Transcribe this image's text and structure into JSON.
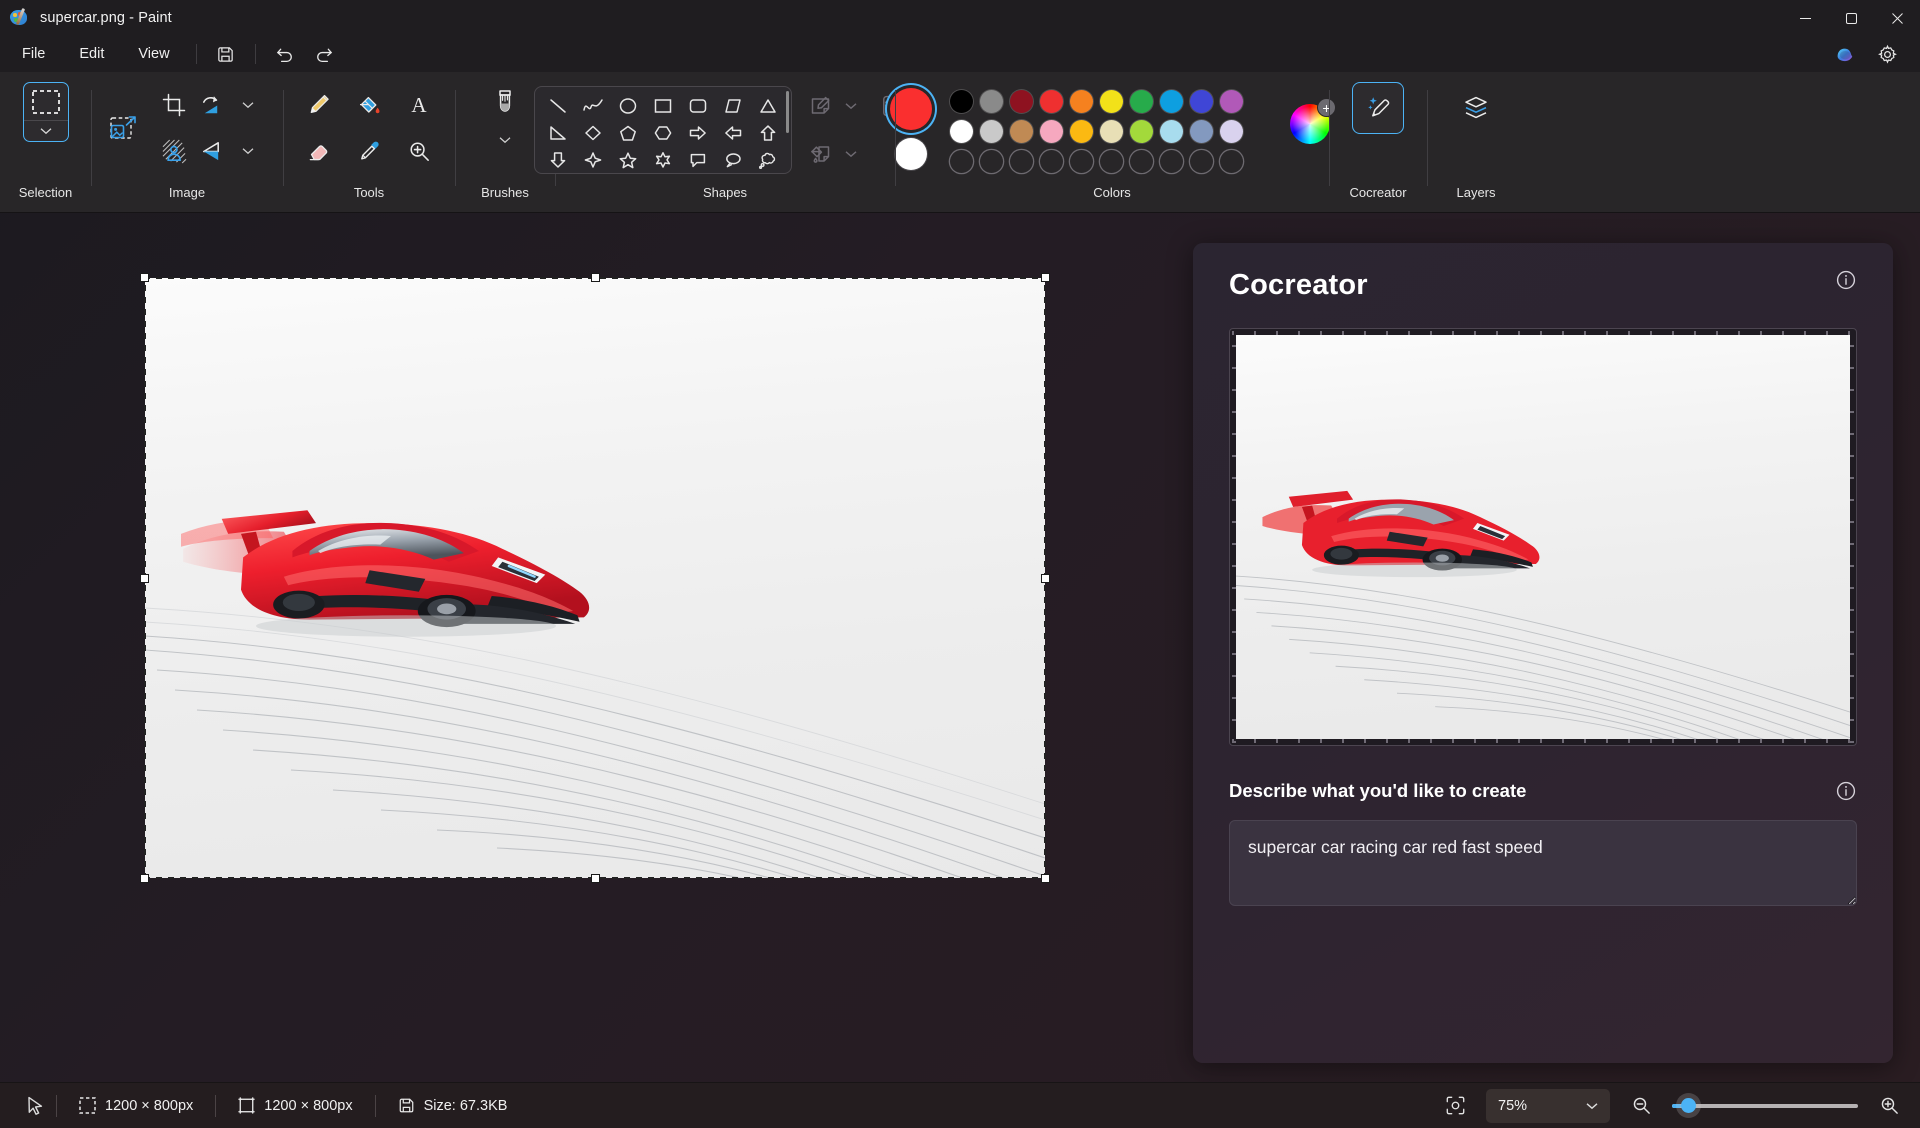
{
  "window": {
    "title": "supercar.png - Paint",
    "app_icon": "paint-palette-icon",
    "minimize": "minimize-icon",
    "maximize": "maximize-icon",
    "close": "close-icon"
  },
  "menubar": {
    "items": [
      {
        "label": "File"
      },
      {
        "label": "Edit"
      },
      {
        "label": "View"
      }
    ],
    "quick_actions": [
      {
        "name": "save-icon",
        "tooltip": "Save"
      },
      {
        "name": "undo-icon",
        "tooltip": "Undo"
      },
      {
        "name": "redo-icon",
        "tooltip": "Redo"
      }
    ],
    "right_actions": [
      {
        "name": "copilot-icon",
        "tooltip": "Copilot"
      },
      {
        "name": "settings-gear-icon",
        "tooltip": "Settings"
      }
    ]
  },
  "ribbon": {
    "groups": [
      {
        "label": "Selection",
        "active": true
      },
      {
        "label": "Image"
      },
      {
        "label": "Tools"
      },
      {
        "label": "Brushes"
      },
      {
        "label": "Shapes"
      },
      {
        "label": "Colors"
      },
      {
        "label": "Cocreator",
        "active": true
      },
      {
        "label": "Layers"
      }
    ],
    "image_tools": [
      "crop-icon",
      "rotate-icon",
      "rotate-chevron-icon",
      "resize-image-icon",
      "remove-background-icon",
      "flip-icon",
      "flip-chevron-icon"
    ],
    "tools": [
      "pencil-icon",
      "fill-bucket-icon",
      "text-tool-icon",
      "eraser-icon",
      "eyedropper-icon",
      "magnifier-tool-icon"
    ],
    "brushes": {
      "icon": "brush-icon",
      "chevron": "chevron-down-icon"
    },
    "shapes": [
      "line-shape",
      "curve-shape",
      "oval-shape",
      "rectangle-shape",
      "rounded-rectangle-shape",
      "parallelogram-shape",
      "triangle-shape",
      "right-triangle-shape",
      "diamond-shape",
      "pentagon-shape",
      "hexagon-shape",
      "right-arrow-shape",
      "left-arrow-shape",
      "up-arrow-shape",
      "down-arrow-shape",
      "four-point-star-shape",
      "five-point-star-shape",
      "six-point-star-shape",
      "rounded-callout-shape",
      "oval-callout-shape",
      "cloud-callout-shape"
    ],
    "shape_side_controls": [
      "outline-style-icon",
      "outline-chevron-icon",
      "fill-style-icon",
      "fill-chevron-icon",
      "brush-texture-icon",
      "texture-chevron-icon"
    ]
  },
  "colors": {
    "primary": "#fa2f2f",
    "secondary": "#ffffff",
    "primary_selected": true,
    "row1": [
      "#000000",
      "#8a8a8a",
      "#8e1220",
      "#ef3030",
      "#f5811f",
      "#f2e119",
      "#27ab4b",
      "#0e9fe0",
      "#3f46d6",
      "#b159b8"
    ],
    "row2": [
      "#ffffff",
      "#c9c9c9",
      "#c08a54",
      "#f6a8bf",
      "#fbb912",
      "#e8dfb6",
      "#a3d93b",
      "#a8dcee",
      "#8399bf",
      "#d9d2ee"
    ],
    "row3": [
      "",
      "",
      "",
      "",
      "",
      "",
      "",
      "",
      "",
      ""
    ],
    "wheel": {
      "name": "color-wheel-icon",
      "badge": "+"
    }
  },
  "canvas": {
    "image_alt": "red-supercar-speed-lines",
    "selection_active": true
  },
  "cocreator": {
    "title": "Cocreator",
    "info_icon": "info-icon",
    "preview_alt": "red-supercar-preview",
    "prompt_label": "Describe what you'd like to create",
    "prompt_info_icon": "info-icon",
    "prompt_value": "supercar car racing car red fast speed",
    "prompt_placeholder": "Describe what you'd like to create"
  },
  "statusbar": {
    "cursor_icon": "cursor-arrow-icon",
    "selection_size": "1200 × 800px",
    "selection_icon": "selection-dashed-icon",
    "canvas_size": "1200 × 800px",
    "canvas_icon": "canvas-frame-icon",
    "file_size": "Size: 67.3KB",
    "file_icon": "save-disk-icon",
    "fit_icon": "fit-to-window-icon",
    "zoom_level": "75%",
    "zoom_chevron": "chevron-down-icon",
    "zoom_out_icon": "zoom-out-icon",
    "zoom_in_icon": "zoom-in-icon",
    "zoom_slider_percent": 5
  }
}
